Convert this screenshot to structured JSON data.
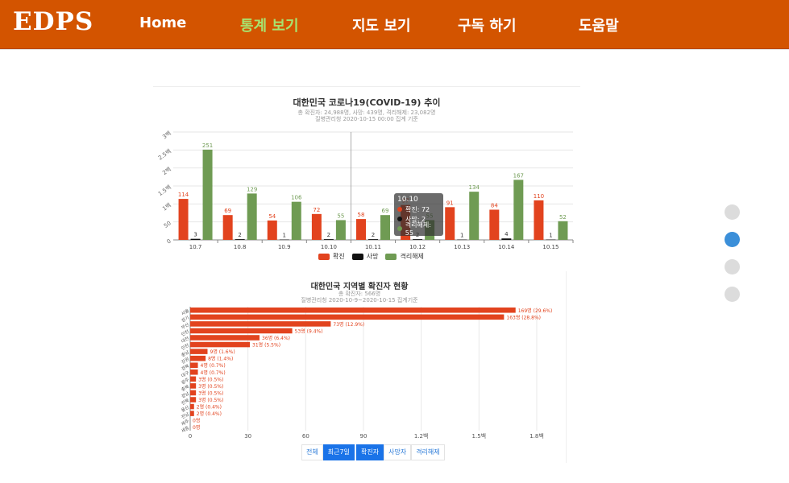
{
  "nav": {
    "logo": "EDPS",
    "items": [
      "Home",
      "통계 보기",
      "지도 보기",
      "구독 하기",
      "도움말"
    ],
    "active_index": 1
  },
  "chart1": {
    "title": "대한민국 코로나19(COVID-19) 추이",
    "subtitle_line1": "총 확진자: 24,988명, 사망: 439명, 격리해제: 23,082명",
    "subtitle_line2": "질병관리청 2020-10-15 00:00 집계 기준",
    "legend": [
      "확진",
      "사망",
      "격리해제"
    ],
    "tooltip": {
      "date": "10.10",
      "rows": [
        "확진: 72",
        "사망: 2",
        "격리해제: 55"
      ]
    }
  },
  "chart2": {
    "title": "대한민국 지역별 확진자 현황",
    "subtitle_line1": "총 확진자: 566명",
    "subtitle_line2": "질병관리청 2020-10-9~2020-10-15 집계기준",
    "buttons_period": [
      "전체",
      "최근7일"
    ],
    "buttons_type": [
      "확진자",
      "사망자",
      "격리해제"
    ]
  },
  "colors": {
    "brand": "#d35400",
    "confirmed": "#e2431e",
    "death": "#111111",
    "released": "#6f9b53",
    "active_dot": "#3b8fd9"
  },
  "chart_data": [
    {
      "type": "bar",
      "title": "대한민국 코로나19(COVID-19) 추이",
      "categories": [
        "10.7",
        "10.8",
        "10.9",
        "10.10",
        "10.11",
        "10.12",
        "10.13",
        "10.14",
        "10.15"
      ],
      "series": [
        {
          "name": "확진",
          "values": [
            114,
            69,
            54,
            72,
            58,
            97,
            91,
            84,
            110
          ],
          "color": "#e2431e"
        },
        {
          "name": "사망",
          "values": [
            3,
            2,
            1,
            2,
            2,
            2,
            1,
            4,
            1
          ],
          "color": "#111111"
        },
        {
          "name": "격리해제",
          "values": [
            251,
            129,
            106,
            55,
            69,
            55,
            134,
            167,
            52
          ],
          "color": "#6f9b53"
        }
      ],
      "yticks": [
        "0",
        "50",
        "1백",
        "1.5백",
        "2백",
        "2.5백",
        "3백"
      ],
      "ylim": [
        0,
        300
      ],
      "grid": true,
      "legend": "bottom"
    },
    {
      "type": "bar",
      "orientation": "horizontal",
      "title": "대한민국 지역별 확진자 현황",
      "categories": [
        "서울",
        "경기",
        "부산",
        "인천",
        "대전",
        "인천",
        "충남",
        "강원",
        "경북",
        "대구",
        "광주",
        "충북",
        "경남",
        "전북",
        "울산",
        "전남",
        "제주",
        "세종"
      ],
      "values": [
        169,
        163,
        73,
        53,
        36,
        31,
        9,
        8,
        4,
        4,
        3,
        3,
        3,
        3,
        2,
        2,
        0,
        0
      ],
      "labels": [
        "169명 (29.6%)",
        "163명 (28.8%)",
        "73명 (12.9%)",
        "53명 (9.4%)",
        "36명 (6.4%)",
        "31명 (5.5%)",
        "9명 (1.6%)",
        "8명 (1.4%)",
        "4명 (0.7%)",
        "4명 (0.7%)",
        "3명 (0.5%)",
        "3명 (0.5%)",
        "3명 (0.5%)",
        "3명 (0.5%)",
        "2명 (0.4%)",
        "2명 (0.4%)",
        "0명",
        "0명"
      ],
      "xticks": [
        "0",
        "30",
        "60",
        "90",
        "1.2백",
        "1.5백",
        "1.8백"
      ],
      "xlim": [
        0,
        180
      ],
      "color": "#e2431e",
      "grid": true
    }
  ],
  "page_indicators": 4,
  "active_indicator": 1
}
